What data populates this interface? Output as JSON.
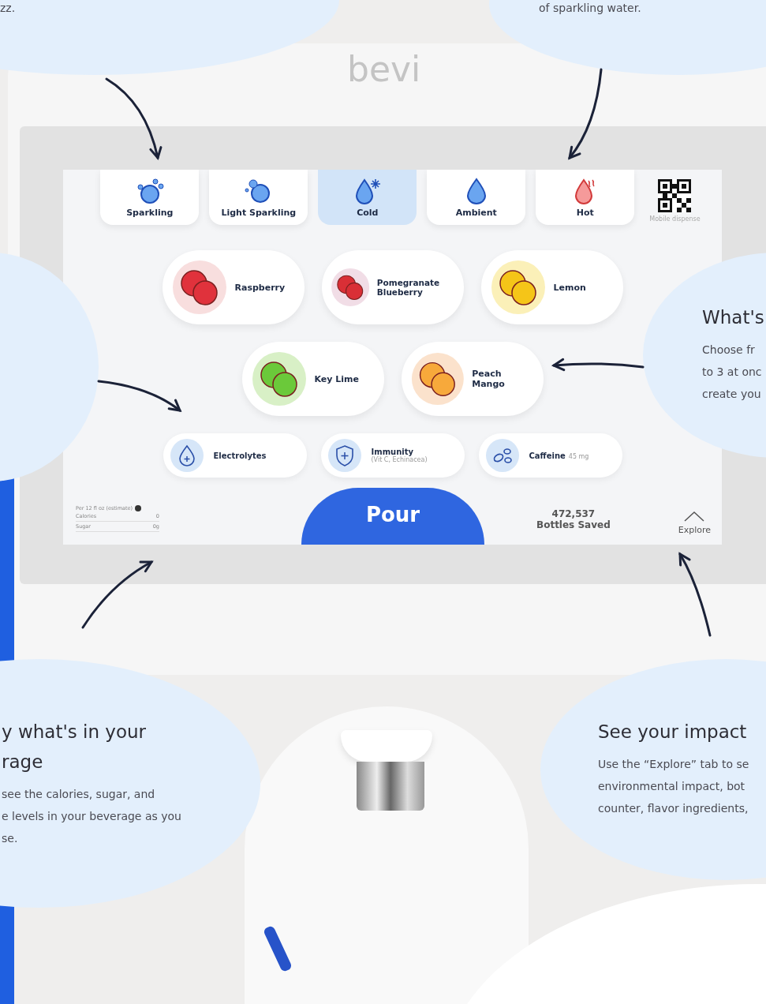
{
  "device": {
    "logo": "bevi"
  },
  "callouts": [
    {
      "lines": [
        "zz."
      ]
    },
    {
      "lines": [
        "of sparkling water."
      ]
    },
    {
      "title_lines": [
        "What's"
      ],
      "lines": [
        "Choose fr",
        "to 3 at onc",
        "create you"
      ]
    },
    {
      "title_lines": [
        "y what's in your",
        "rage"
      ],
      "lines": [
        "see the calories, sugar, and",
        "e levels in your beverage as you",
        "se."
      ]
    },
    {
      "title_lines": [
        "See your impact"
      ],
      "lines": [
        "Use the “Explore” tab to se",
        "environmental impact, bot",
        "counter, flavor ingredients,"
      ]
    }
  ],
  "screen": {
    "temperatures": [
      {
        "label": "Sparkling",
        "selected": false
      },
      {
        "label": "Light Sparkling",
        "selected": false
      },
      {
        "label": "Cold",
        "selected": true
      },
      {
        "label": "Ambient",
        "selected": false
      },
      {
        "label": "Hot",
        "selected": false
      }
    ],
    "qr": {
      "caption": "Mobile dispense"
    },
    "flavor_rows": [
      [
        {
          "name": "Raspberry"
        },
        {
          "name": "Pomegranate Blueberry"
        },
        {
          "name": "Lemon"
        }
      ],
      [
        {
          "name": "Key Lime"
        },
        {
          "name": "Peach Mango"
        }
      ]
    ],
    "boosts": [
      {
        "name": "Electrolytes"
      },
      {
        "name": "Immunity",
        "detail": "(Vit C, Echinacea)"
      },
      {
        "name": "Caffeine",
        "detail": "45 mg"
      }
    ],
    "nutrition": {
      "heading": "Per 12 fl oz (estimate)",
      "rows": [
        {
          "label": "Calories",
          "value": "0"
        },
        {
          "label": "Sugar",
          "value": "0g"
        }
      ]
    },
    "pour": "Pour",
    "bottles": {
      "count": "472,537",
      "label": "Bottles Saved"
    },
    "explore": "Explore"
  }
}
